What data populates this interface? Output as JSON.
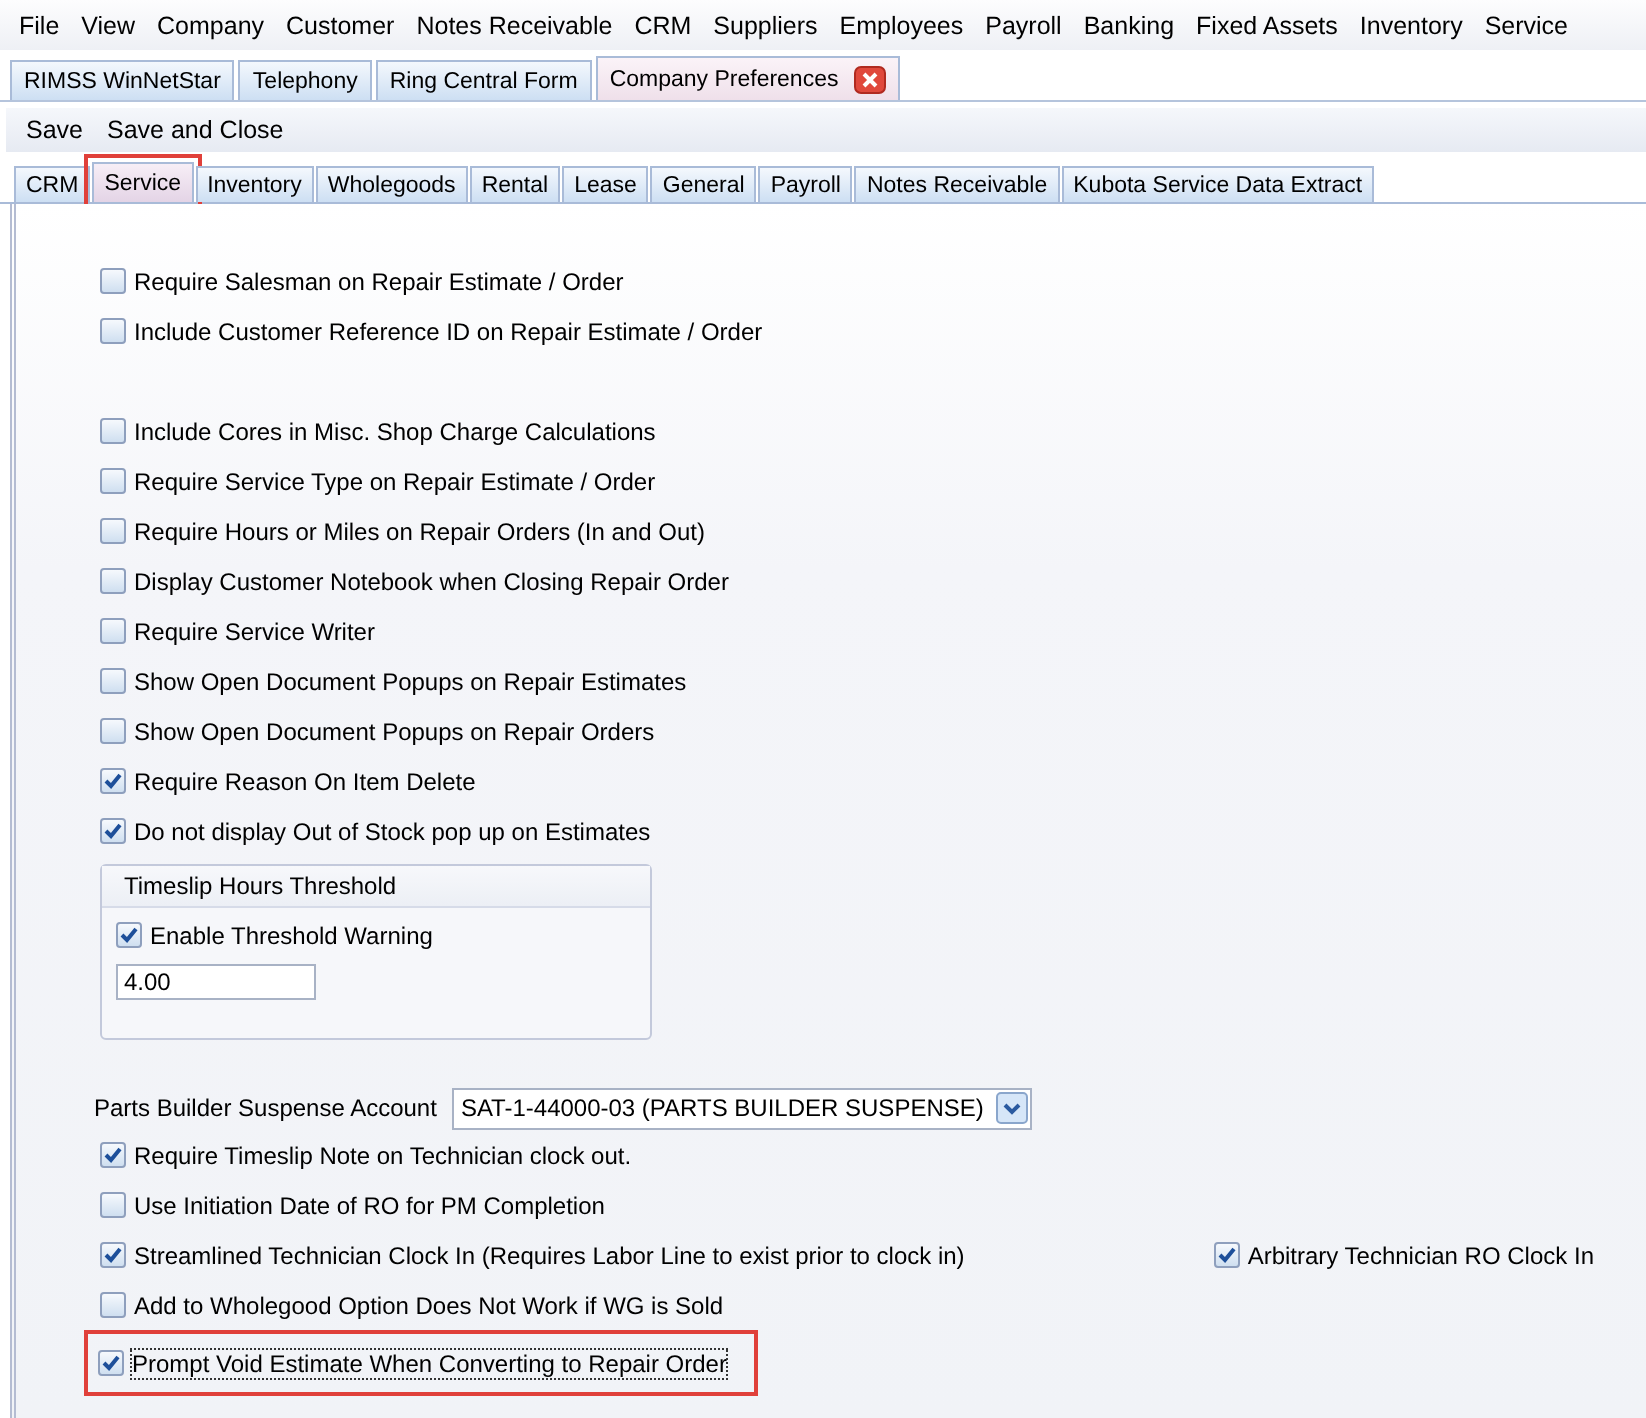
{
  "menu": [
    "File",
    "View",
    "Company",
    "Customer",
    "Notes Receivable",
    "CRM",
    "Suppliers",
    "Employees",
    "Payroll",
    "Banking",
    "Fixed Assets",
    "Inventory",
    "Service"
  ],
  "document_tabs": [
    {
      "label": "RIMSS WinNetStar",
      "selected": false,
      "closable": false
    },
    {
      "label": "Telephony",
      "selected": false,
      "closable": false
    },
    {
      "label": "Ring Central Form",
      "selected": false,
      "closable": false
    },
    {
      "label": "Company Preferences",
      "selected": true,
      "closable": true
    }
  ],
  "toolbar": [
    "Save",
    "Save and Close"
  ],
  "preference_tabs": [
    {
      "label": "CRM",
      "selected": false,
      "highlighted": false
    },
    {
      "label": "Service",
      "selected": true,
      "highlighted": true
    },
    {
      "label": "Inventory",
      "selected": false,
      "highlighted": false
    },
    {
      "label": "Wholegoods",
      "selected": false,
      "highlighted": false
    },
    {
      "label": "Rental",
      "selected": false,
      "highlighted": false
    },
    {
      "label": "Lease",
      "selected": false,
      "highlighted": false
    },
    {
      "label": "General",
      "selected": false,
      "highlighted": false
    },
    {
      "label": "Payroll",
      "selected": false,
      "highlighted": false
    },
    {
      "label": "Notes Receivable",
      "selected": false,
      "highlighted": false
    },
    {
      "label": "Kubota Service Data Extract",
      "selected": false,
      "highlighted": false
    }
  ],
  "options_first": [
    {
      "label": "Require Salesman on Repair Estimate / Order",
      "checked": false
    },
    {
      "label": "Include Customer Reference ID on Repair Estimate / Order",
      "checked": false
    }
  ],
  "options_second": [
    {
      "label": "Include Cores in Misc. Shop Charge Calculations",
      "checked": false
    },
    {
      "label": "Require Service Type on Repair Estimate / Order",
      "checked": false
    },
    {
      "label": "Require Hours or Miles on Repair Orders (In and Out)",
      "checked": false
    },
    {
      "label": "Display Customer Notebook when Closing Repair Order",
      "checked": false
    },
    {
      "label": "Require Service Writer",
      "checked": false
    },
    {
      "label": "Show Open Document Popups on Repair Estimates",
      "checked": false
    },
    {
      "label": "Show Open Document Popups on Repair Orders",
      "checked": false
    },
    {
      "label": "Require Reason On Item Delete",
      "checked": true
    },
    {
      "label": "Do not display Out of Stock pop up on Estimates",
      "checked": true
    }
  ],
  "timeslip_group": {
    "title": "Timeslip Hours Threshold",
    "option": {
      "label": "Enable Threshold Warning",
      "checked": true
    },
    "value": "4.00"
  },
  "parts_builder": {
    "label": "Parts Builder Suspense Account",
    "value": "SAT-1-44000-03 (PARTS BUILDER SUSPENSE)"
  },
  "options_third": [
    {
      "label": "Require Timeslip Note on Technician clock out.",
      "checked": true,
      "highlighted": false,
      "focused": false
    },
    {
      "label": "Use Initiation Date of RO for PM Completion",
      "checked": false,
      "highlighted": false,
      "focused": false
    },
    {
      "label": "Streamlined Technician Clock In (Requires Labor Line to exist prior to clock in)",
      "checked": true,
      "highlighted": false,
      "focused": false,
      "side_option": {
        "label": "Arbitrary Technician RO Clock In",
        "checked": true
      }
    },
    {
      "label": "Add to Wholegood Option Does Not Work if WG is Sold",
      "checked": false,
      "highlighted": false,
      "focused": false
    },
    {
      "label": "Prompt Void Estimate When Converting to Repair Order",
      "checked": true,
      "highlighted": true,
      "focused": true
    }
  ]
}
